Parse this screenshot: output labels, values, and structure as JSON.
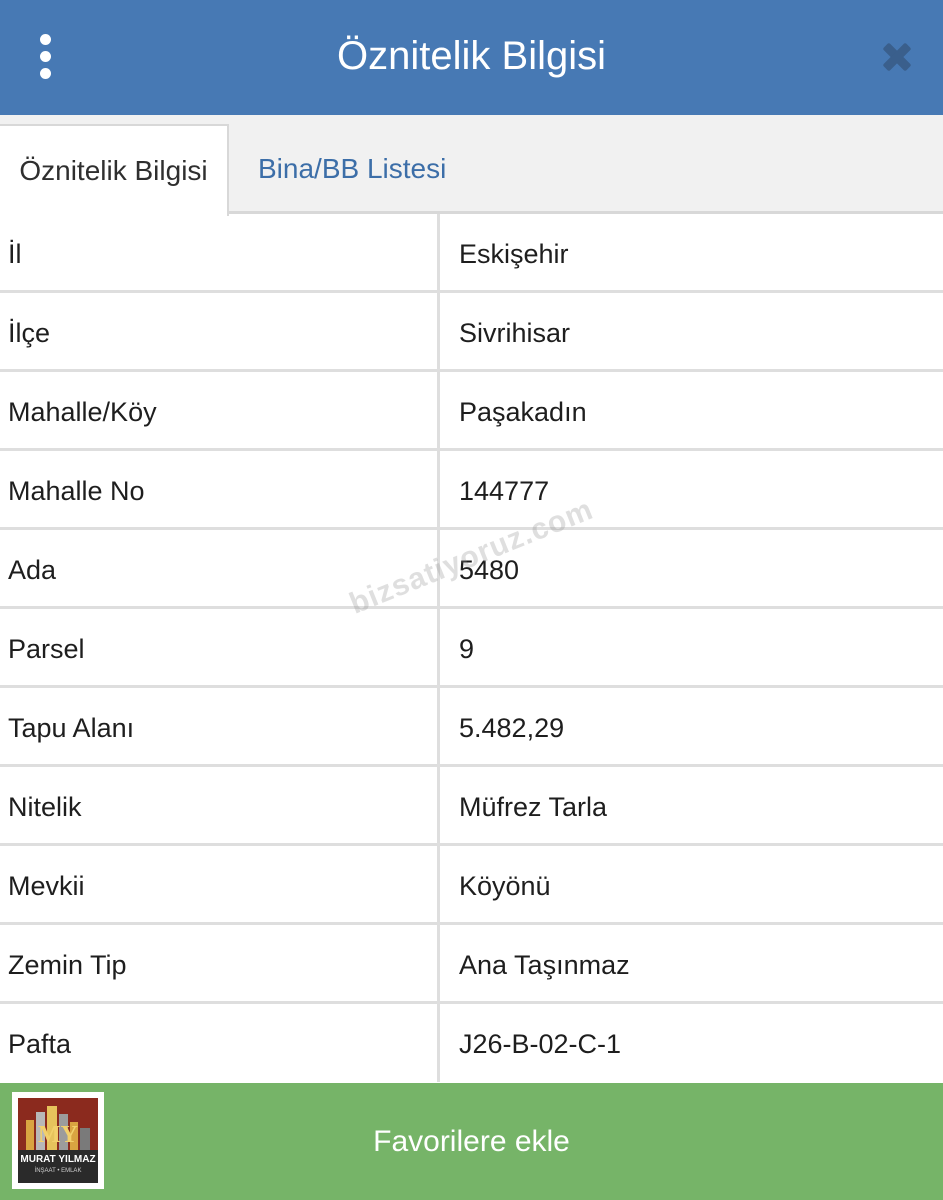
{
  "header": {
    "title": "Öznitelik Bilgisi",
    "menu_icon": "more-vertical-icon",
    "close_icon": "close-icon"
  },
  "tabs": [
    {
      "label": "Öznitelik Bilgisi",
      "active": true
    },
    {
      "label": "Bina/BB Listesi",
      "active": false
    }
  ],
  "attributes": [
    {
      "key": "İl",
      "value": "Eskişehir"
    },
    {
      "key": "İlçe",
      "value": "Sivrihisar"
    },
    {
      "key": "Mahalle/Köy",
      "value": "Paşakadın"
    },
    {
      "key": "Mahalle No",
      "value": "144777"
    },
    {
      "key": "Ada",
      "value": "5480"
    },
    {
      "key": "Parsel",
      "value": "9"
    },
    {
      "key": "Tapu Alanı",
      "value": "5.482,29"
    },
    {
      "key": "Nitelik",
      "value": "Müfrez Tarla"
    },
    {
      "key": "Mevkii",
      "value": "Köyönü"
    },
    {
      "key": "Zemin Tip",
      "value": "Ana Taşınmaz"
    },
    {
      "key": "Pafta",
      "value": "J26-B-02-C-1"
    }
  ],
  "watermark": "bizsatiyoruz.com",
  "footer": {
    "button_label": "Favorilere ekle",
    "logo": {
      "name": "MURAT YILMAZ",
      "subtitle": "İNŞAAT • EMLAK"
    }
  },
  "colors": {
    "header_bg": "#4779b4",
    "tab_link": "#3c6ea8",
    "footer_bg": "#76b468"
  }
}
